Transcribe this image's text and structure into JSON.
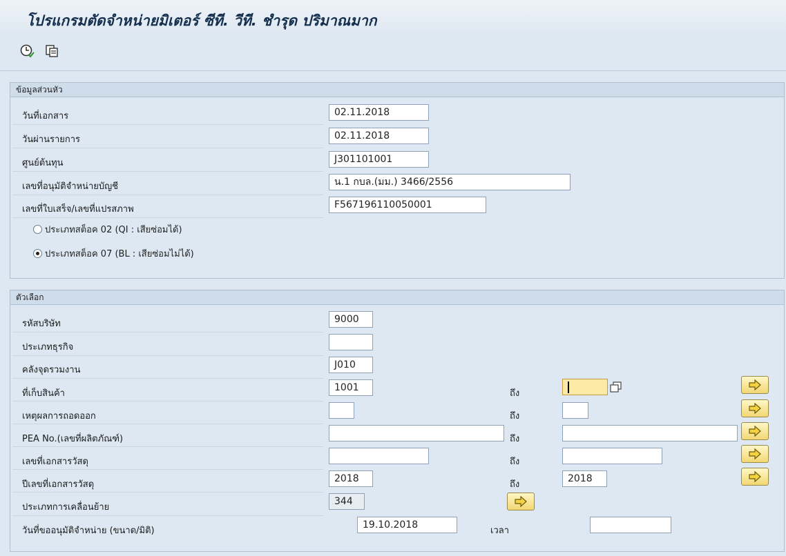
{
  "title": "โปรแกรมตัดจำหน่ายมิเตอร์ ซีที. วีที. ชำรุด ปริมาณมาก",
  "toolbar": {
    "execute_icon": "execute-clock-icon",
    "variant_icon": "get-variant-icon"
  },
  "header_section": {
    "title": "ข้อมูลส่วนหัว",
    "document_date_label": "วันที่เอกสาร",
    "document_date": "02.11.2018",
    "posting_date_label": "วันผ่านรายการ",
    "posting_date": "02.11.2018",
    "cost_center_label": "ศูนย์ต้นทุน",
    "cost_center": "J301101001",
    "writeoff_approval_label": "เลขที่อนุมัติจำหน่ายบัญชี",
    "writeoff_approval": "น.1 กบล.(มม.) 3466/2556",
    "receipt_no_label": "เลขที่ใบเสร็จ/เลขที่แปรสภาพ",
    "receipt_no": "F567196110050001",
    "radio_stock02_label": "ประเภทสต็อค 02 (QI : เสียซ่อมได้)",
    "radio_stock07_label": "ประเภทสต็อค 07 (BL : เสียซ่อมไม่ได้)",
    "selected_radio": "stock07"
  },
  "options_section": {
    "title": "ตัวเลือก",
    "to_label": "ถึง",
    "company_code_label": "รหัสบริษัท",
    "company_code": "9000",
    "business_area_label": "ประเภทธุรกิจ",
    "business_area": "",
    "plant_label": "คลังจุดรวมงาน",
    "plant": "J010",
    "storage_location_label": "ที่เก็บสินค้า",
    "storage_location_from": "1001",
    "storage_location_to": "",
    "removal_reason_label": "เหตุผลการถอดออก",
    "removal_reason_from": "",
    "removal_reason_to": "",
    "pea_no_label": "PEA No.(เลขที่ผลิตภัณฑ์)",
    "pea_no_from": "",
    "pea_no_to": "",
    "material_doc_label": "เลขที่เอกสารวัสดุ",
    "material_doc_from": "",
    "material_doc_to": "",
    "material_doc_year_label": "ปีเลขที่เอกสารวัสดุ",
    "material_doc_year_from": "2018",
    "material_doc_year_to": "2018",
    "movement_type_label": "ประเภทการเคลื่อนย้าย",
    "movement_type": "344",
    "approval_request_date_label": "วันที่ขออนุมัติจำหน่าย (ขนาด/มิติ)",
    "approval_request_date": "19.10.2018",
    "time_label": "เวลา",
    "time": ""
  }
}
